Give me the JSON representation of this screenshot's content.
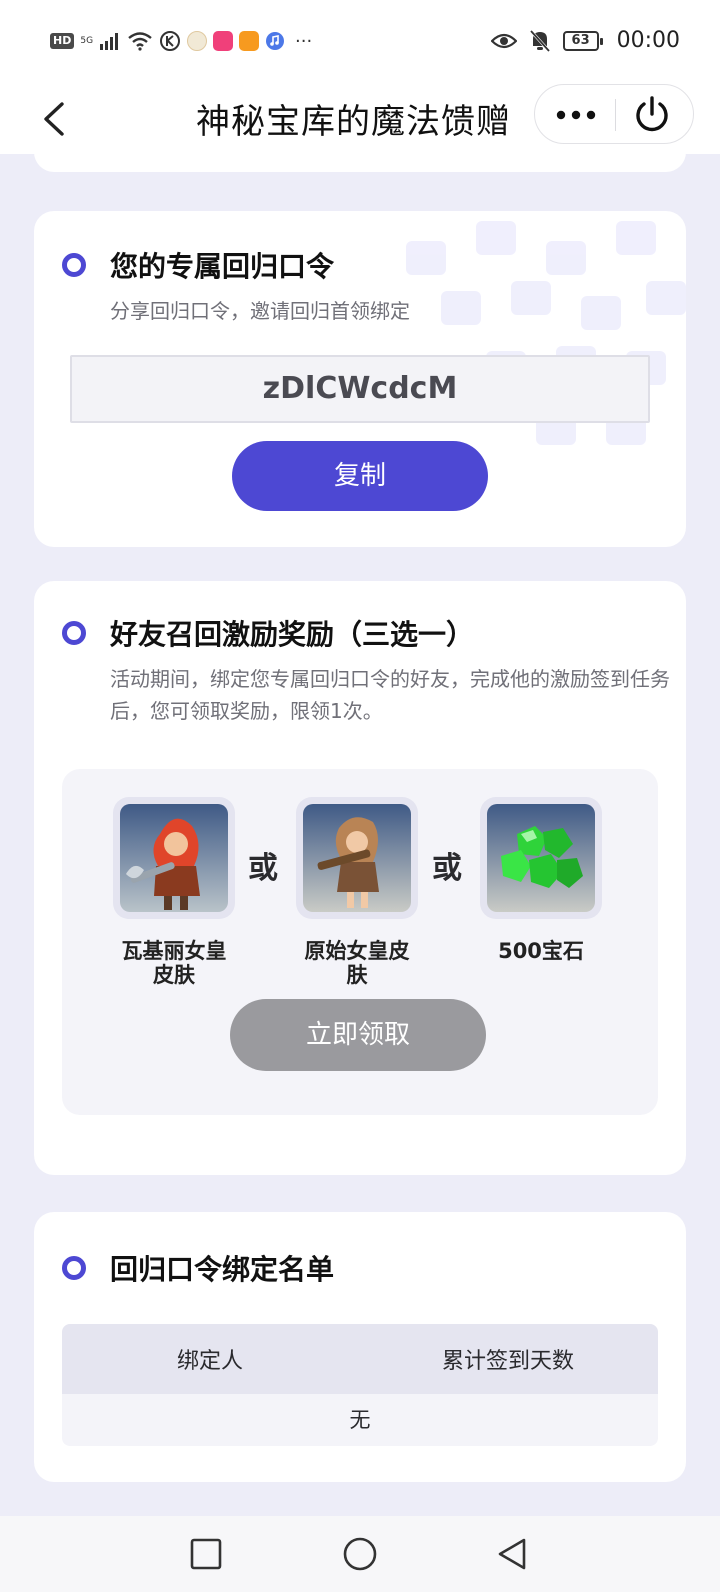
{
  "status_bar": {
    "hd": "HD",
    "signal_label": "5G",
    "battery": "63",
    "time": "00:00",
    "more_dots": "···"
  },
  "nav": {
    "title": "神秘宝库的魔法馈赠"
  },
  "code_card": {
    "title": "您的专属回归口令",
    "subtitle": "分享回归口令，邀请回归首领绑定",
    "code": "zDlCWcdcM",
    "copy_label": "复制"
  },
  "reward_card": {
    "title": "好友召回激励奖励（三选一）",
    "description": "活动期间，绑定您专属回归口令的好友，完成他的激励签到任务后，您可领取奖励，限领1次。",
    "or_label": "或",
    "items": [
      {
        "name": "瓦基丽女皇皮肤",
        "icon": "valkyrie-queen-skin-image"
      },
      {
        "name": "原始女皇皮肤",
        "icon": "primal-queen-skin-image"
      },
      {
        "name": "500宝石",
        "icon": "gems-image"
      }
    ],
    "claim_label": "立即领取"
  },
  "binding_card": {
    "title": "回归口令绑定名单",
    "columns": [
      "绑定人",
      "累计签到天数"
    ],
    "empty_text": "无"
  },
  "colors": {
    "accent": "#4d48d3",
    "disabled": "#9a9a9e",
    "background": "#ededf8"
  }
}
